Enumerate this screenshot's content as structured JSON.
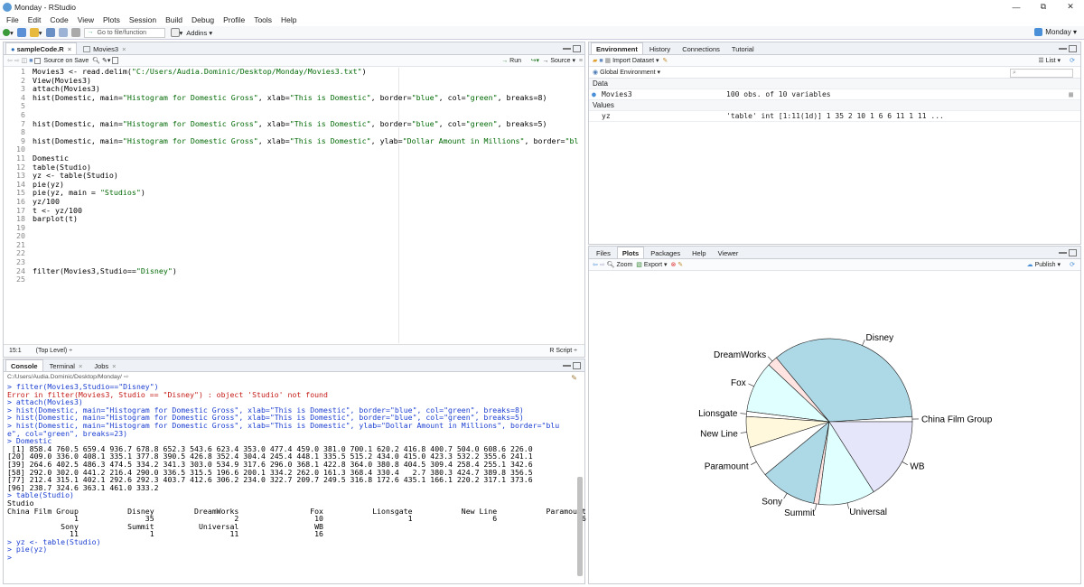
{
  "window": {
    "title": "Monday - RStudio",
    "min": "—",
    "max": "⧉",
    "close": "✕"
  },
  "menu": [
    "File",
    "Edit",
    "Code",
    "View",
    "Plots",
    "Session",
    "Build",
    "Debug",
    "Profile",
    "Tools",
    "Help"
  ],
  "toolbar": {
    "goto_placeholder": "Go to file/function",
    "addins": "Addins",
    "project": "Monday"
  },
  "editor": {
    "tabs": [
      {
        "label": "sampleCode.R"
      },
      {
        "label": "Movies3"
      }
    ],
    "source_on_save": "Source on Save",
    "run": "Run",
    "source": "Source",
    "lines": [
      "Movies3 <- read.delim(\"C:/Users/Audia.Dominic/Desktop/Monday/Movies3.txt\")",
      "View(Movies3)",
      "attach(Movies3)",
      "hist(Domestic, main=\"Histogram for Domestic Gross\", xlab=\"This is Domestic\", border=\"blue\", col=\"green\", breaks=8)",
      "",
      "",
      "hist(Domestic, main=\"Histogram for Domestic Gross\", xlab=\"This is Domestic\", border=\"blue\", col=\"green\", breaks=5)",
      "",
      "hist(Domestic, main=\"Histogram for Domestic Gross\", xlab=\"This is Domestic\", ylab=\"Dollar Amount in Millions\", border=\"bl",
      "",
      "Domestic",
      "table(Studio)",
      "yz <- table(Studio)",
      "pie(yz)",
      "pie(yz, main = \"Studios\")",
      "yz/100",
      "t <- yz/100",
      "barplot(t)",
      "",
      "",
      "",
      "",
      "",
      "filter(Movies3,Studio==\"Disney\")",
      ""
    ],
    "cursor": "15:1",
    "scope": "(Top Level) ÷",
    "filetype": "R Script ÷"
  },
  "console": {
    "tabs": [
      {
        "label": "Console"
      },
      {
        "label": "Terminal"
      },
      {
        "label": "Jobs"
      }
    ],
    "path": "C:/Users/Audia.Dominic/Desktop/Monday/",
    "output": [
      {
        "t": "cmd",
        "s": "> filter(Movies3,Studio==\"Disney\")"
      },
      {
        "t": "err",
        "s": "Error in filter(Movies3, Studio == \"Disney\") : object 'Studio' not found"
      },
      {
        "t": "cmd",
        "s": "> attach(Movies3)"
      },
      {
        "t": "cmd",
        "s": "> hist(Domestic, main=\"Histogram for Domestic Gross\", xlab=\"This is Domestic\", border=\"blue\", col=\"green\", breaks=8)"
      },
      {
        "t": "cmd",
        "s": "> hist(Domestic, main=\"Histogram for Domestic Gross\", xlab=\"This is Domestic\", border=\"blue\", col=\"green\", breaks=5)"
      },
      {
        "t": "cmd",
        "s": "> hist(Domestic, main=\"Histogram for Domestic Gross\", xlab=\"This is Domestic\", ylab=\"Dollar Amount in Millions\", border=\"blu"
      },
      {
        "t": "cmd",
        "s": "e\", col=\"green\", breaks=23)"
      },
      {
        "t": "cmd",
        "s": "> Domestic"
      },
      {
        "t": "out",
        "s": " [1] 858.4 760.5 659.4 936.7 678.8 652.3 543.6 623.4 353.0 477.4 459.0 381.0 700.1 620.2 416.8 400.7 504.0 608.6 226.0"
      },
      {
        "t": "out",
        "s": "[20] 409.0 336.0 408.1 335.1 377.8 390.5 426.8 352.4 304.4 245.4 448.1 335.5 515.2 434.0 415.0 423.3 532.2 355.6 241.1"
      },
      {
        "t": "out",
        "s": "[39] 264.6 402.5 486.3 474.5 334.2 341.3 303.0 534.9 317.6 296.0 368.1 422.8 364.0 380.8 404.5 309.4 258.4 255.1 342.6"
      },
      {
        "t": "out",
        "s": "[58] 292.0 302.0 441.2 216.4 290.0 336.5 315.5 196.6 200.1 334.2 262.0 161.3 368.4 330.4   2.7 380.3 424.7 389.8 356.5"
      },
      {
        "t": "out",
        "s": "[77] 212.4 315.1 402.1 292.6 292.3 403.7 412.6 306.2 234.0 322.7 209.7 249.5 316.8 172.6 435.1 166.1 220.2 317.1 373.6"
      },
      {
        "t": "out",
        "s": "[96] 238.7 324.6 363.1 461.0 333.2"
      },
      {
        "t": "cmd",
        "s": "> table(Studio)"
      },
      {
        "t": "out",
        "s": "Studio"
      },
      {
        "t": "out",
        "s": "China Film Group           Disney         DreamWorks                Fox           Lionsgate           New Line           Paramount"
      },
      {
        "t": "out",
        "s": "               1               35                  2                 10                   1                  6                   6"
      },
      {
        "t": "out",
        "s": "            Sony           Summit          Universal                 WB"
      },
      {
        "t": "out",
        "s": "              11                1                 11                 16"
      },
      {
        "t": "cmd",
        "s": "> yz <- table(Studio)"
      },
      {
        "t": "cmd",
        "s": "> pie(yz)"
      },
      {
        "t": "cmd",
        "s": "> "
      }
    ]
  },
  "environment": {
    "tabs": [
      {
        "label": "Environment"
      },
      {
        "label": "History"
      },
      {
        "label": "Connections"
      },
      {
        "label": "Tutorial"
      }
    ],
    "import": "Import Dataset",
    "list": "List",
    "scope": "Global Environment",
    "data_header": "Data",
    "values_header": "Values",
    "data": [
      {
        "name": "Movies3",
        "value": "100 obs. of 10 variables"
      }
    ],
    "values": [
      {
        "name": "yz",
        "value": "'table' int [1:11(1d)] 1 35 2 10 1 6 6 11 1 11 ..."
      }
    ]
  },
  "files": {
    "tabs": [
      {
        "label": "Files"
      },
      {
        "label": "Plots"
      },
      {
        "label": "Packages"
      },
      {
        "label": "Help"
      },
      {
        "label": "Viewer"
      }
    ],
    "zoom": "Zoom",
    "export": "Export",
    "publish": "Publish"
  },
  "chart_data": {
    "type": "pie",
    "categories": [
      "China Film Group",
      "Disney",
      "DreamWorks",
      "Fox",
      "Lionsgate",
      "New Line",
      "Paramount",
      "Sony",
      "Summit",
      "Universal",
      "WB"
    ],
    "values": [
      1,
      35,
      2,
      10,
      1,
      6,
      6,
      11,
      1,
      11,
      16
    ],
    "colors": [
      "#ffffff",
      "#add8e6",
      "#ffe4e1",
      "#e0ffff",
      "#ffffff",
      "#fff8dc",
      "#ffffff",
      "#add8e6",
      "#ffe4e1",
      "#e0ffff",
      "#e6e6fa"
    ],
    "title": ""
  }
}
